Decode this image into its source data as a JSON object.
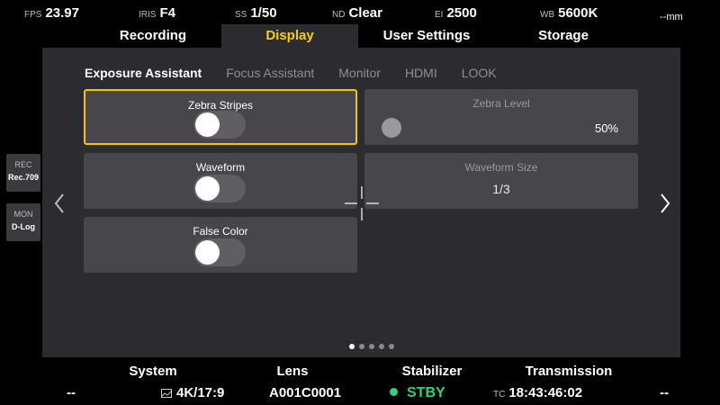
{
  "status": {
    "fps": {
      "label": "FPS",
      "value": "23.97"
    },
    "iris": {
      "label": "IRIS",
      "value": "F4"
    },
    "ss": {
      "label": "SS",
      "value": "1/50"
    },
    "nd": {
      "label": "ND",
      "value": "Clear"
    },
    "ei": {
      "label": "EI",
      "value": "2500"
    },
    "wb": {
      "label": "WB",
      "value": "5600K"
    },
    "focal": {
      "value": "--mm"
    }
  },
  "tabs": [
    {
      "label": "Recording"
    },
    {
      "label": "Display",
      "active": true
    },
    {
      "label": "User Settings"
    },
    {
      "label": "Storage"
    }
  ],
  "subtabs": [
    {
      "label": "Exposure Assistant",
      "active": true
    },
    {
      "label": "Focus Assistant"
    },
    {
      "label": "Monitor"
    },
    {
      "label": "HDMI"
    },
    {
      "label": "LOOK"
    }
  ],
  "settings": {
    "zebra_stripes": {
      "title": "Zebra Stripes",
      "on": false
    },
    "zebra_level": {
      "title": "Zebra Level",
      "value": "50%"
    },
    "waveform": {
      "title": "Waveform",
      "on": false
    },
    "waveform_size": {
      "title": "Waveform Size",
      "value": "1/3"
    },
    "false_color": {
      "title": "False Color",
      "on": false
    }
  },
  "pagination": {
    "pages": 5,
    "current": 1
  },
  "side": {
    "rec": {
      "label": "REC",
      "value": "Rec.709"
    },
    "mon": {
      "label": "MON",
      "value": "D-Log"
    }
  },
  "bottom": {
    "system": {
      "title": "System",
      "value": "--"
    },
    "lens": {
      "title": "Lens",
      "resolution": "4K/17:9",
      "clip": "A001C0001"
    },
    "stabilizer": {
      "title": "Stabilizer",
      "state": "STBY"
    },
    "transmission": {
      "title": "Transmission",
      "tc_label": "TC",
      "timecode": "18:43:46:02",
      "value": "--"
    }
  },
  "colors": {
    "accent": "#f7d100",
    "selected_border": "#f5c400",
    "stby_green": "#2ed47a",
    "panel": "#2c2b30",
    "card": "#47464b"
  }
}
